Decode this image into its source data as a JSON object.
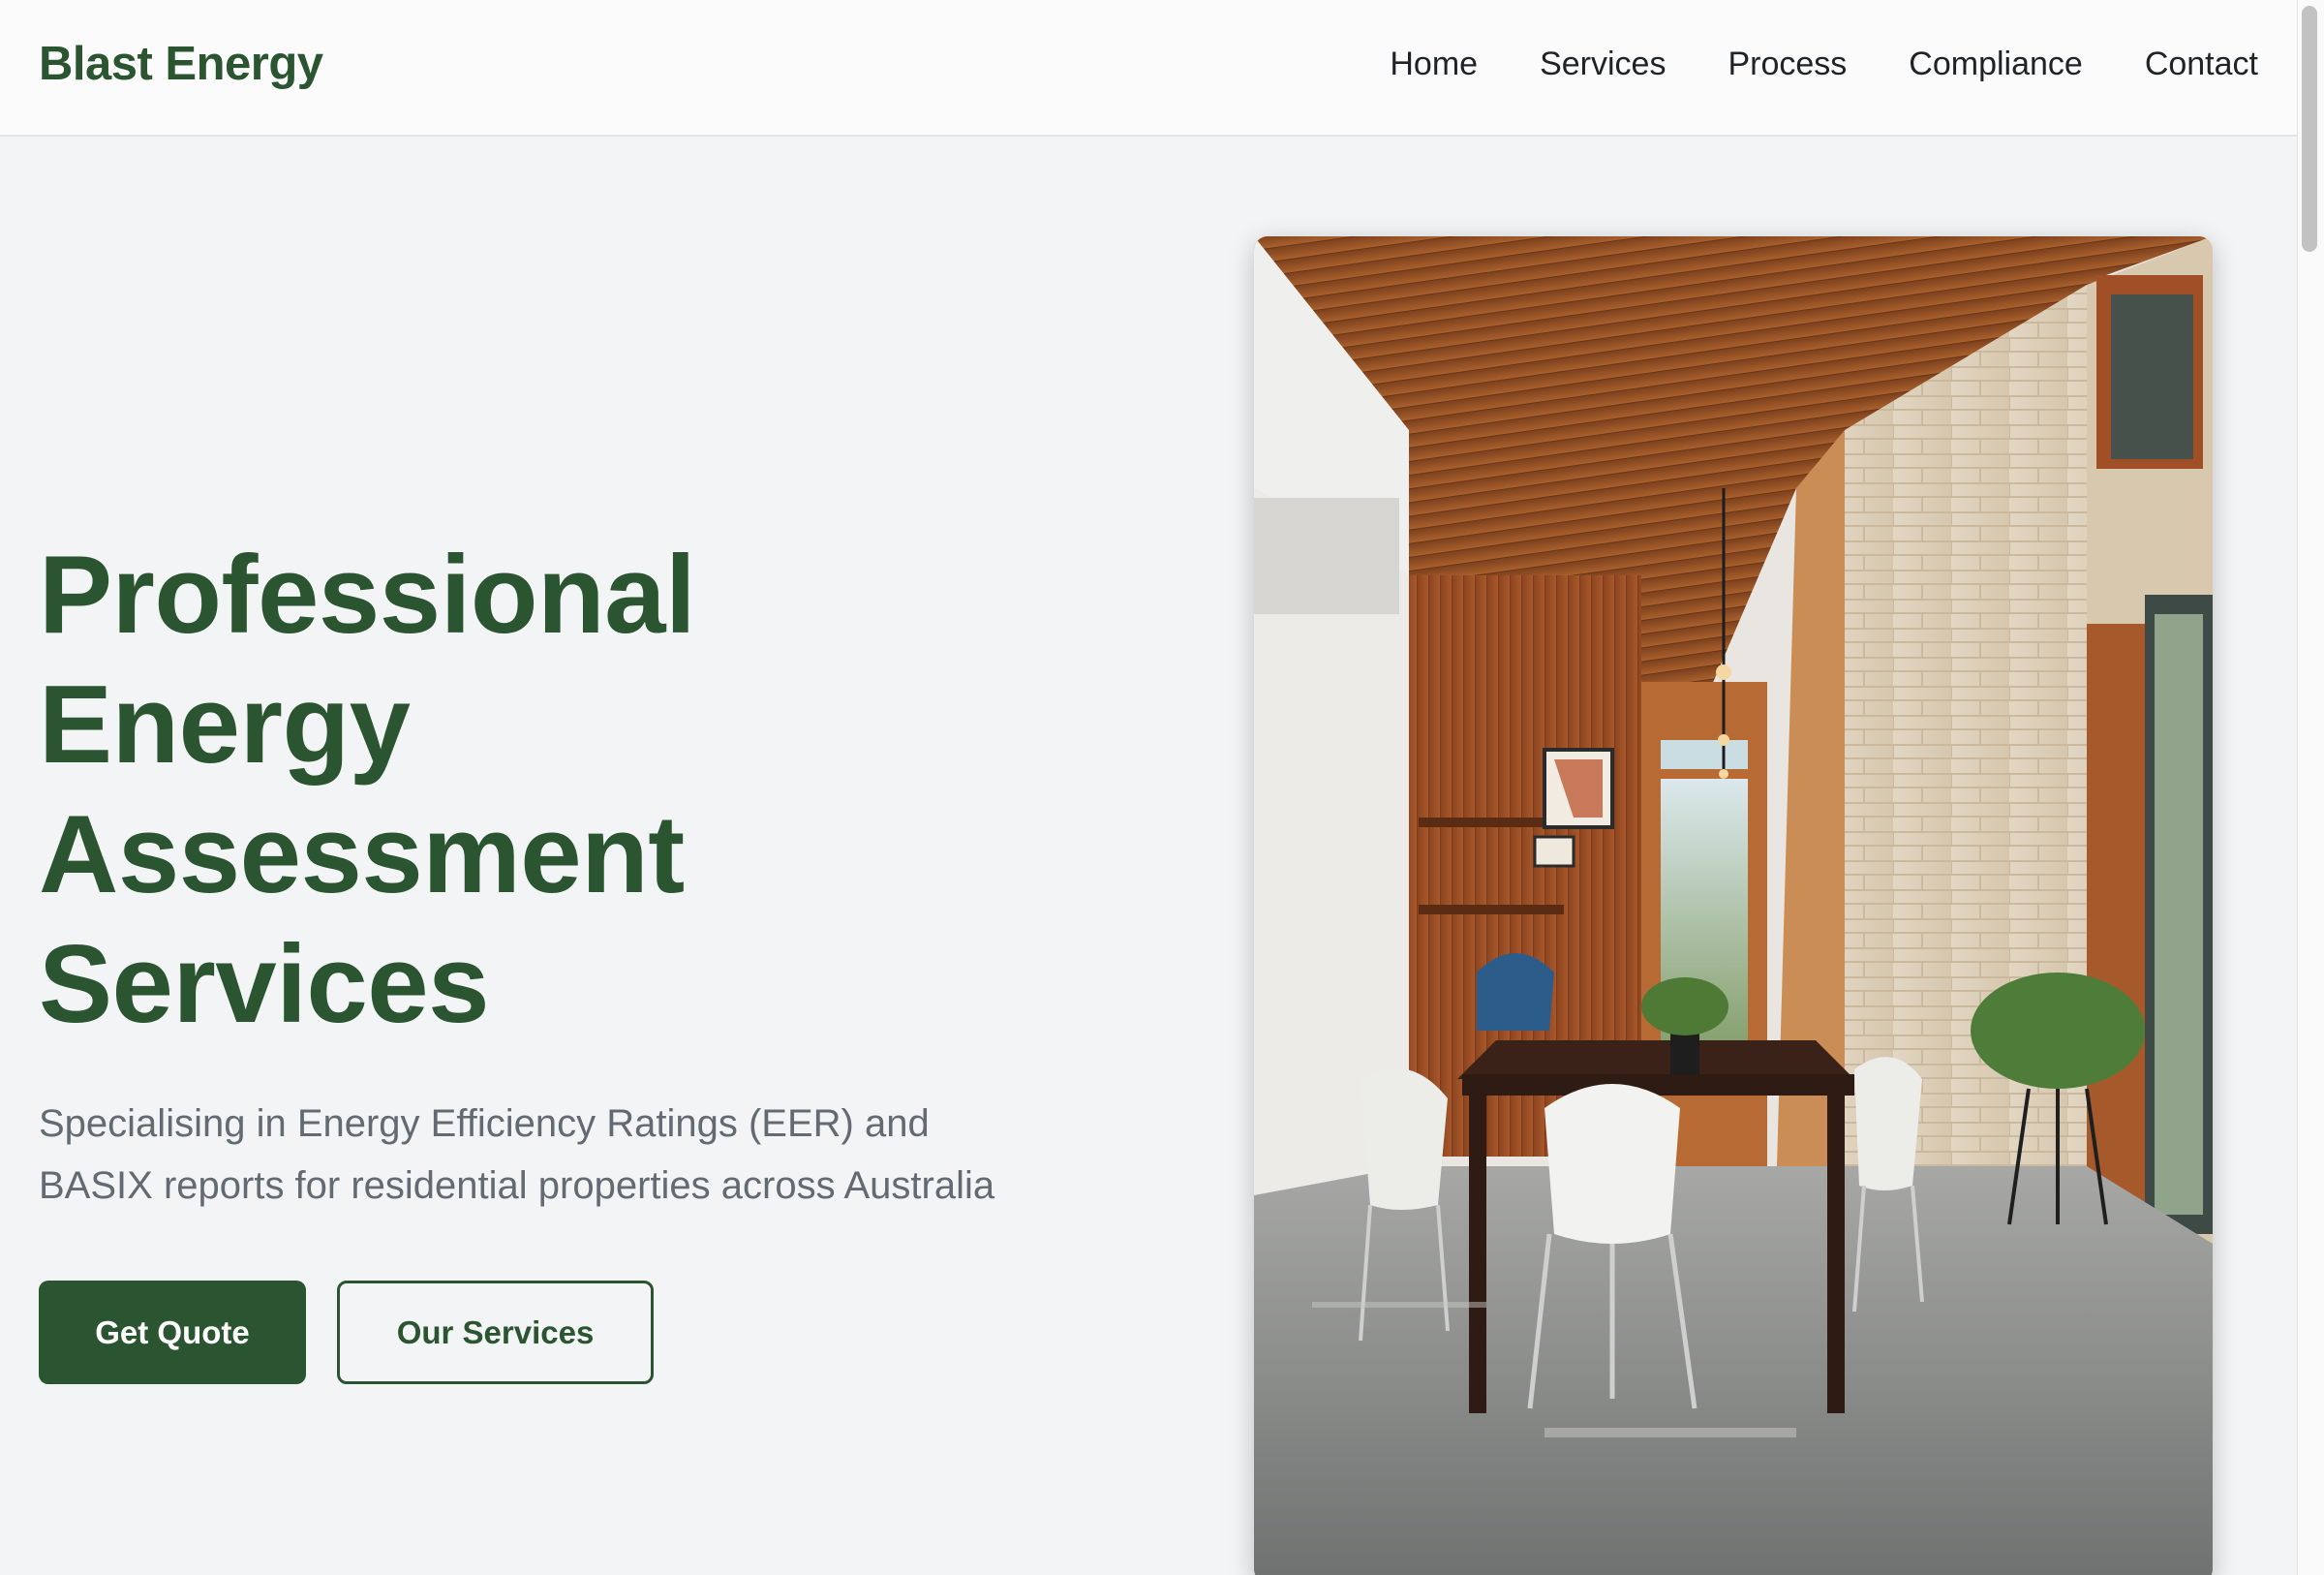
{
  "header": {
    "brand": "Blast Energy",
    "nav": [
      {
        "label": "Home"
      },
      {
        "label": "Services"
      },
      {
        "label": "Process"
      },
      {
        "label": "Compliance"
      },
      {
        "label": "Contact"
      }
    ]
  },
  "hero": {
    "title_lines": [
      "Professional",
      "Energy",
      "Assessment",
      "Services"
    ],
    "subtitle_lines": [
      "Specialising in Energy Efficiency Ratings (EER) and",
      "BASIX reports for residential properties across Australia"
    ],
    "primary_button": "Get Quote",
    "secondary_button": "Our Services",
    "image_subject": "modern-interior-dining-photo"
  },
  "colors": {
    "brand_green": "#2b5530",
    "background": "#f3f4f5",
    "subtitle_gray": "#636a71",
    "nav_text": "#1f2328"
  }
}
